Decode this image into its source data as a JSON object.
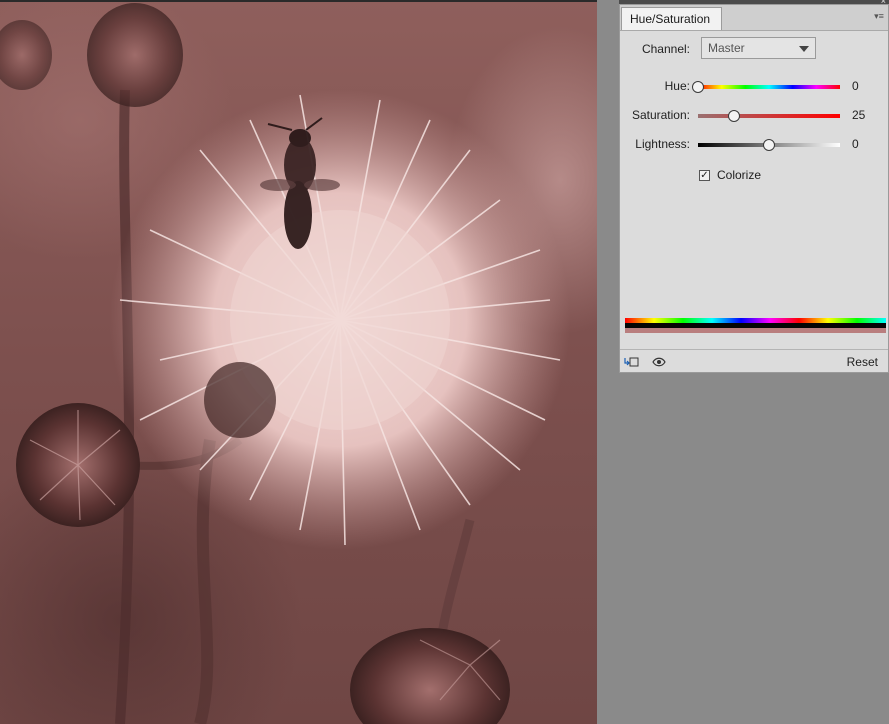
{
  "panel": {
    "tab_label": "Hue/Saturation",
    "channel_label": "Channel:",
    "channel_value": "Master",
    "hue_label": "Hue:",
    "hue_value": "0",
    "hue_level": 0.0,
    "saturation_label": "Saturation:",
    "saturation_value": "25",
    "saturation_level": 0.25,
    "lightness_label": "Lightness:",
    "lightness_value": "0",
    "lightness_level": 0.5,
    "colorize_label": "Colorize",
    "colorize_checked": true,
    "reset_label": "Reset",
    "close_glyph": "×",
    "menu_glyph": "▾≡",
    "check_glyph": "✓"
  },
  "icons": {
    "clip": "clip-to-layer-icon",
    "eye": "visibility-eye-icon"
  },
  "colors": {
    "panel_bg": "#dcdcdc",
    "workspace_bg": "#8a8a8a",
    "photo_tint": "#8f5f5c"
  }
}
